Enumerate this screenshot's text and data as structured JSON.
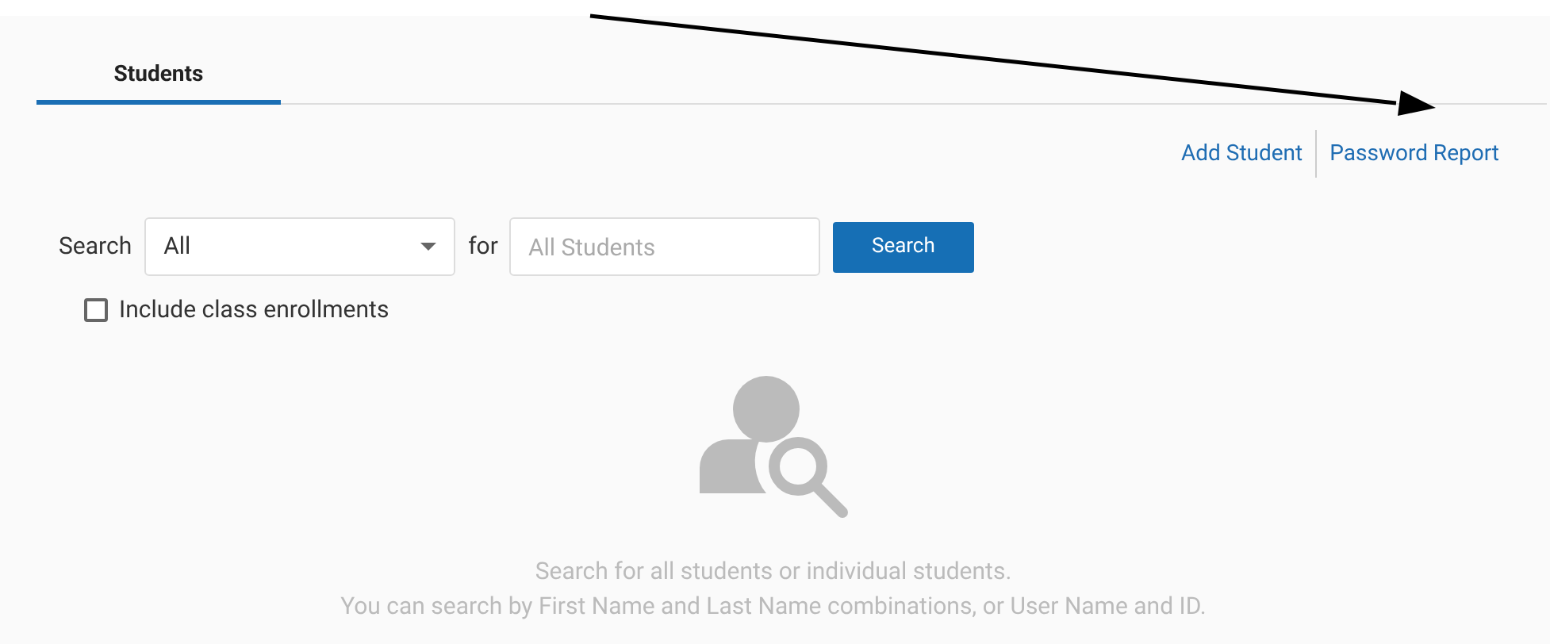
{
  "tabs": [
    {
      "label": "Students",
      "selected": true
    }
  ],
  "actions": [
    "Add Student",
    "Password Report"
  ],
  "search": {
    "label": "Search",
    "scope": "All",
    "connector": "for",
    "placeholder": "All Students",
    "button": "Search"
  },
  "include_class_enrollments": {
    "label": "Include class enrollments",
    "checked": false
  },
  "empty_state": {
    "lines": [
      "Search for all students or individual students.",
      "You can search by First Name and Last Name combinations, or User Name and ID."
    ]
  }
}
